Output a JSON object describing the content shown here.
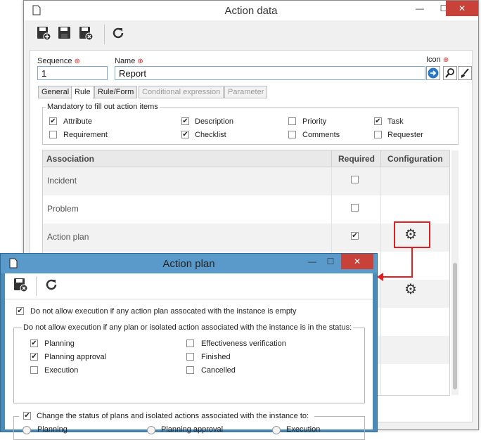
{
  "main": {
    "title": "Action data",
    "toolbar": {
      "buttons": [
        "save-and-new-icon",
        "save-icon",
        "save-and-close-icon",
        "refresh-icon"
      ]
    },
    "fields": {
      "sequence_label": "Sequence",
      "sequence_value": "1",
      "name_label": "Name",
      "name_value": "Report",
      "icon_label": "Icon"
    },
    "tabs": [
      {
        "label": "General",
        "enabled": true
      },
      {
        "label": "Rule",
        "enabled": true,
        "active": true
      },
      {
        "label": "Rule/Form",
        "enabled": true
      },
      {
        "label": "Conditional expression",
        "enabled": false
      },
      {
        "label": "Parameter",
        "enabled": false
      }
    ],
    "mandatory": {
      "title": "Mandatory to fill out action items",
      "items": [
        {
          "label": "Attribute",
          "checked": true
        },
        {
          "label": "Description",
          "checked": true
        },
        {
          "label": "Priority",
          "checked": false
        },
        {
          "label": "Task",
          "checked": true
        },
        {
          "label": "Requirement",
          "checked": false
        },
        {
          "label": "Checklist",
          "checked": true
        },
        {
          "label": "Comments",
          "checked": false
        },
        {
          "label": "Requester",
          "checked": false
        }
      ]
    },
    "grid": {
      "columns": [
        "Association",
        "Required",
        "Configuration"
      ],
      "rows": [
        {
          "association": "Incident",
          "required": false,
          "config": false
        },
        {
          "association": "Problem",
          "required": false,
          "config": false
        },
        {
          "association": "Action plan",
          "required": true,
          "config": true
        }
      ]
    }
  },
  "popup": {
    "title": "Action plan",
    "toolbar": {
      "buttons": [
        "save-and-close-icon",
        "refresh-icon"
      ]
    },
    "option1": {
      "label": "Do not allow execution if any action plan assocated with the instance is empty",
      "checked": true
    },
    "status_group": {
      "title": "Do not allow execution if any plan or isolated action associated with the instance is in the status:",
      "items": [
        {
          "label": "Planning",
          "checked": true
        },
        {
          "label": "Effectiveness verification",
          "checked": false
        },
        {
          "label": "Planning approval",
          "checked": true
        },
        {
          "label": "Finished",
          "checked": false
        },
        {
          "label": "Execution",
          "checked": false
        },
        {
          "label": "Cancelled",
          "checked": false
        }
      ]
    },
    "change_group": {
      "title": "Change the status of plans and isolated actions associated with the instance to:",
      "checked": true,
      "options": [
        "Planning",
        "Planning approval",
        "Execution"
      ]
    }
  },
  "colors": {
    "accent": "#2d78c4",
    "highlight_box": "#e02020",
    "popup_frame": "#4a8ab8",
    "close_button": "#c9423a"
  }
}
